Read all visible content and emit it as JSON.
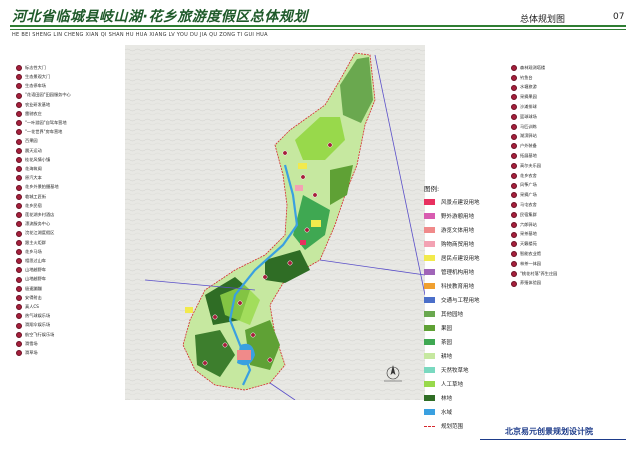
{
  "header": {
    "title": "河北省临城县岐山湖·花乡旅游度假区总体规划",
    "subtitle_pinyin": "HE BEI SHENG LIN CHENG XIAN QI SHAN HU   HUA XIANG LV YOU DU JIA QU ZONG TI GUI HUA",
    "section": "总体规划图",
    "page_number": "07"
  },
  "footer": {
    "organization": "北京易元创景规划设计院"
  },
  "left_labels": [
    "标志性大门",
    "生态景观大门",
    "生态停车场",
    "\"花语田园\"田园服务中心",
    "农业研发基地",
    "雷驰农庄",
    "\"一叶游园\"自驾车营地",
    "\"一花世界\"房车营地",
    "百果园",
    "晨天运动",
    "桂花风情小镇",
    "花海筑阁",
    "原汽大本",
    "花乡外景拍摄基地",
    "临城工匠街",
    "花乡民宿",
    "莲花湖乡村酒店",
    "漂流服务中心",
    "浣花江湖度假区",
    "跟主火炬群",
    "花乡马场",
    "相思过山车",
    "山地越野车",
    "山地越野车",
    "极速蹦蹦",
    "安得射击",
    "真人CS",
    "热气球娱乐场",
    "滑翔伞娱乐场",
    "航空飞行娱乐场",
    "滑雪场",
    "滑草场"
  ],
  "right_labels": [
    "森林观测塔楼",
    "钓鱼台",
    "水塘旅游",
    "采摘果园",
    "沙滩排球",
    "篮球球场",
    "马匹训练",
    "湖滨驿站",
    "户外装备",
    "拓展基地",
    "高尔夫乐园",
    "花乡农舍",
    "风筝广场",
    "采摘广场",
    "马屯农舍",
    "民宿集群",
    "六郎驿站",
    "采茶基地",
    "天籁楼苑",
    "智能农业馆",
    "林茶一体园",
    "\"桃花村落\"养生庄园",
    "养殖体验园"
  ],
  "legend": {
    "title": "图例:",
    "items": [
      {
        "label": "风景点建设用地",
        "color": "#e8305f"
      },
      {
        "label": "野外游憩用地",
        "color": "#d85cb0"
      },
      {
        "label": "游览文体用地",
        "color": "#f08a8a"
      },
      {
        "label": "购物商贸用地",
        "color": "#f3a2b3"
      },
      {
        "label": "居民点建设用地",
        "color": "#f2ea4c"
      },
      {
        "label": "管理机构用地",
        "color": "#a065b8"
      },
      {
        "label": "科技教育用地",
        "color": "#f0a030"
      },
      {
        "label": "交通与工程用地",
        "color": "#4b6fc9"
      },
      {
        "label": "其他园地",
        "color": "#6aa84f"
      },
      {
        "label": "果园",
        "color": "#5fa135"
      },
      {
        "label": "茶园",
        "color": "#3fa852"
      },
      {
        "label": "耕地",
        "color": "#c6e8a0"
      },
      {
        "label": "天然牧草地",
        "color": "#7ad9c0"
      },
      {
        "label": "人工草地",
        "color": "#98d94b"
      },
      {
        "label": "林地",
        "color": "#2f6d25"
      },
      {
        "label": "水域",
        "color": "#3aa0e0"
      },
      {
        "label": "规划范围",
        "color": "#d6282e"
      }
    ]
  },
  "colors": {
    "title_green": "#1f5a2a",
    "boundary": "#d6282e",
    "road": "#5a4fc9",
    "forest": "#2f6d25",
    "farmland": "#c6e8a0",
    "orchard": "#6aa84f",
    "water": "#3aa0e0"
  }
}
